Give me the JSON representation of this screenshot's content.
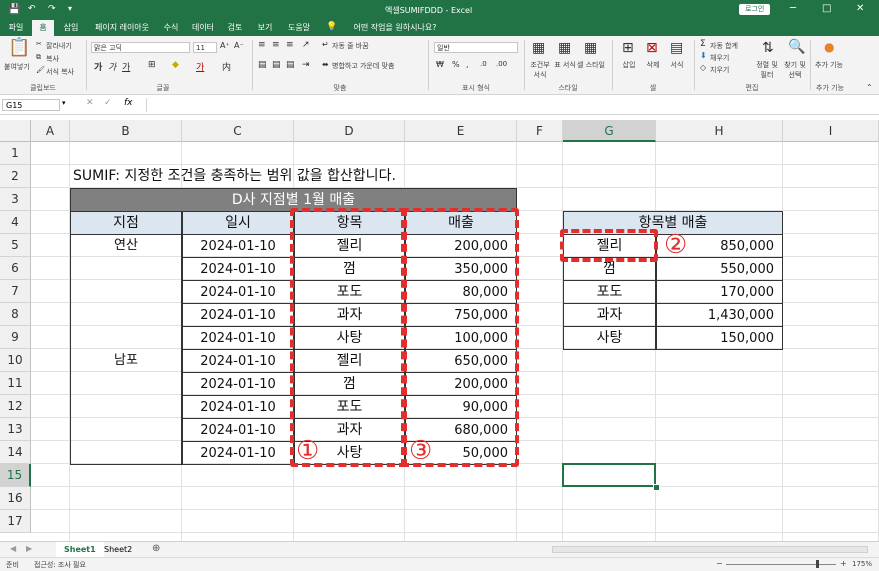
{
  "window": {
    "title": "엑셀SUMIFDDD  -  Excel",
    "login_button": "로그인",
    "controls": [
      "─",
      "□",
      "✕"
    ]
  },
  "tabs": [
    "파일",
    "홈",
    "삽입",
    "페이지 레이아웃",
    "수식",
    "데이터",
    "검토",
    "보기",
    "도움말",
    "어떤 작업을 원하시나요?"
  ],
  "ribbon": {
    "paste_label": "붙여넣기",
    "clipboard_items": [
      "잘라내기",
      "복사",
      "서식 복사"
    ],
    "clipboard_group": "클립보드",
    "font_name": "맑은 고딕",
    "font_size": "11",
    "font_group": "글꼴",
    "wrap_text": "자동 줄 바꿈",
    "merge_center": "병합하고 가운데 맞춤",
    "alignment_group": "맞춤",
    "number_format": "일반",
    "number_group": "표시 형식",
    "style_items": [
      "조건부 서식",
      "표 서식",
      "셀 스타일"
    ],
    "style_group": "스타일",
    "cell_items": [
      "삽입",
      "삭제",
      "서식"
    ],
    "cell_group": "셀",
    "edit_items": [
      "자동 합계",
      "채우기",
      "지우기"
    ],
    "sort_filter": "정렬 및 필터",
    "find_select": "찾기 및 선택",
    "edit_group": "편집",
    "addin_label": "추가 기능",
    "addin_group": "추가 기능"
  },
  "formula_bar": {
    "name_box": "G15",
    "fx": "fx",
    "value": ""
  },
  "columns": [
    "A",
    "B",
    "C",
    "D",
    "E",
    "F",
    "G",
    "H",
    "I"
  ],
  "selected_column": "G",
  "rows": [
    "1",
    "2",
    "3",
    "4",
    "5",
    "6",
    "7",
    "8",
    "9",
    "10",
    "11",
    "12",
    "13",
    "14",
    "15",
    "16",
    "17"
  ],
  "selected_row": "15",
  "sheet": {
    "description": "SUMIF: 지정한 조건을 충족하는 범위 값을 합산합니다.",
    "main_table": {
      "title": "D사 지점별 1월 매출",
      "headers": [
        "지점",
        "일시",
        "항목",
        "매출"
      ],
      "rows": [
        {
          "branch": "연산",
          "date": "2024-01-10",
          "item": "젤리",
          "sales": "200,000"
        },
        {
          "branch": "",
          "date": "2024-01-10",
          "item": "껌",
          "sales": "350,000"
        },
        {
          "branch": "",
          "date": "2024-01-10",
          "item": "포도",
          "sales": "80,000"
        },
        {
          "branch": "",
          "date": "2024-01-10",
          "item": "과자",
          "sales": "750,000"
        },
        {
          "branch": "",
          "date": "2024-01-10",
          "item": "사탕",
          "sales": "100,000"
        },
        {
          "branch": "남포",
          "date": "2024-01-10",
          "item": "젤리",
          "sales": "650,000"
        },
        {
          "branch": "",
          "date": "2024-01-10",
          "item": "껌",
          "sales": "200,000"
        },
        {
          "branch": "",
          "date": "2024-01-10",
          "item": "포도",
          "sales": "90,000"
        },
        {
          "branch": "",
          "date": "2024-01-10",
          "item": "과자",
          "sales": "680,000"
        },
        {
          "branch": "",
          "date": "2024-01-10",
          "item": "사탕",
          "sales": "50,000"
        }
      ]
    },
    "summary_table": {
      "title": "항목별 매출",
      "rows": [
        {
          "item": "젤리",
          "sales": "850,000"
        },
        {
          "item": "껌",
          "sales": "550,000"
        },
        {
          "item": "포도",
          "sales": "170,000"
        },
        {
          "item": "과자",
          "sales": "1,430,000"
        },
        {
          "item": "사탕",
          "sales": "150,000"
        }
      ]
    },
    "annotations": [
      "①",
      "②",
      "③"
    ],
    "annotation_color": "#e32e2e",
    "header_fill": "#dce6f1",
    "title_fill": "#808080"
  },
  "sheet_tabs": [
    "Sheet1",
    "Sheet2"
  ],
  "active_sheet": "Sheet1",
  "status": {
    "ready": "준비",
    "accessibility": "접근성: 조사 필요",
    "zoom": "175%"
  },
  "accent_color": "#217346"
}
